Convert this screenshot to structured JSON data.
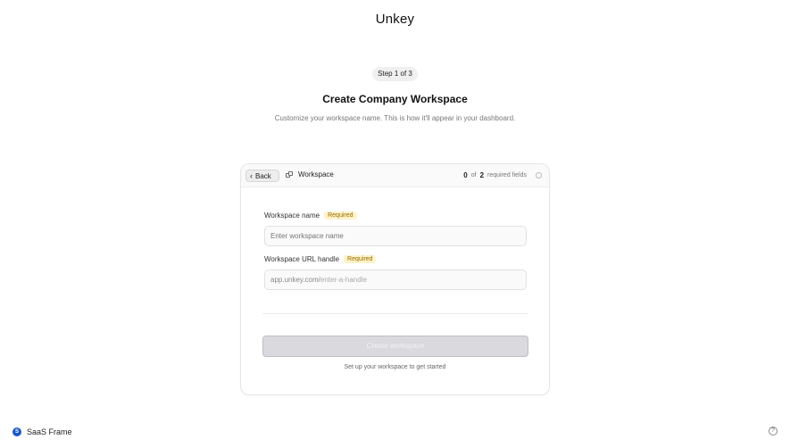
{
  "app": {
    "title": "Unkey"
  },
  "step": {
    "label": "Step 1 of 3"
  },
  "heading": {
    "title": "Create Company Workspace",
    "subtitle": "Customize your workspace name. This is how it'll appear in your dashboard."
  },
  "card": {
    "back_label": "Back",
    "tab_label": "Workspace",
    "required": {
      "done": "0",
      "of_text": "of",
      "total": "2",
      "suffix": "required fields"
    },
    "fields": [
      {
        "label": "Workspace name",
        "badge": "Required",
        "placeholder": "Enter workspace name",
        "value": ""
      },
      {
        "label": "Workspace URL handle",
        "badge": "Required",
        "prefix": "app.unkey.com/",
        "placeholder": "enter-a-handle",
        "value": ""
      }
    ],
    "submit_label": "Create workspace",
    "hint": "Set up your workspace to get started"
  },
  "footer": {
    "logo_letter": "S",
    "brand_name": "SaaS Frame",
    "help_glyph": "?"
  },
  "colors": {
    "badge_bg": "#fff3c9",
    "badge_text": "#9a6a00",
    "button_disabled": "#d9d9de",
    "footer_logo": "#1c57c9"
  }
}
